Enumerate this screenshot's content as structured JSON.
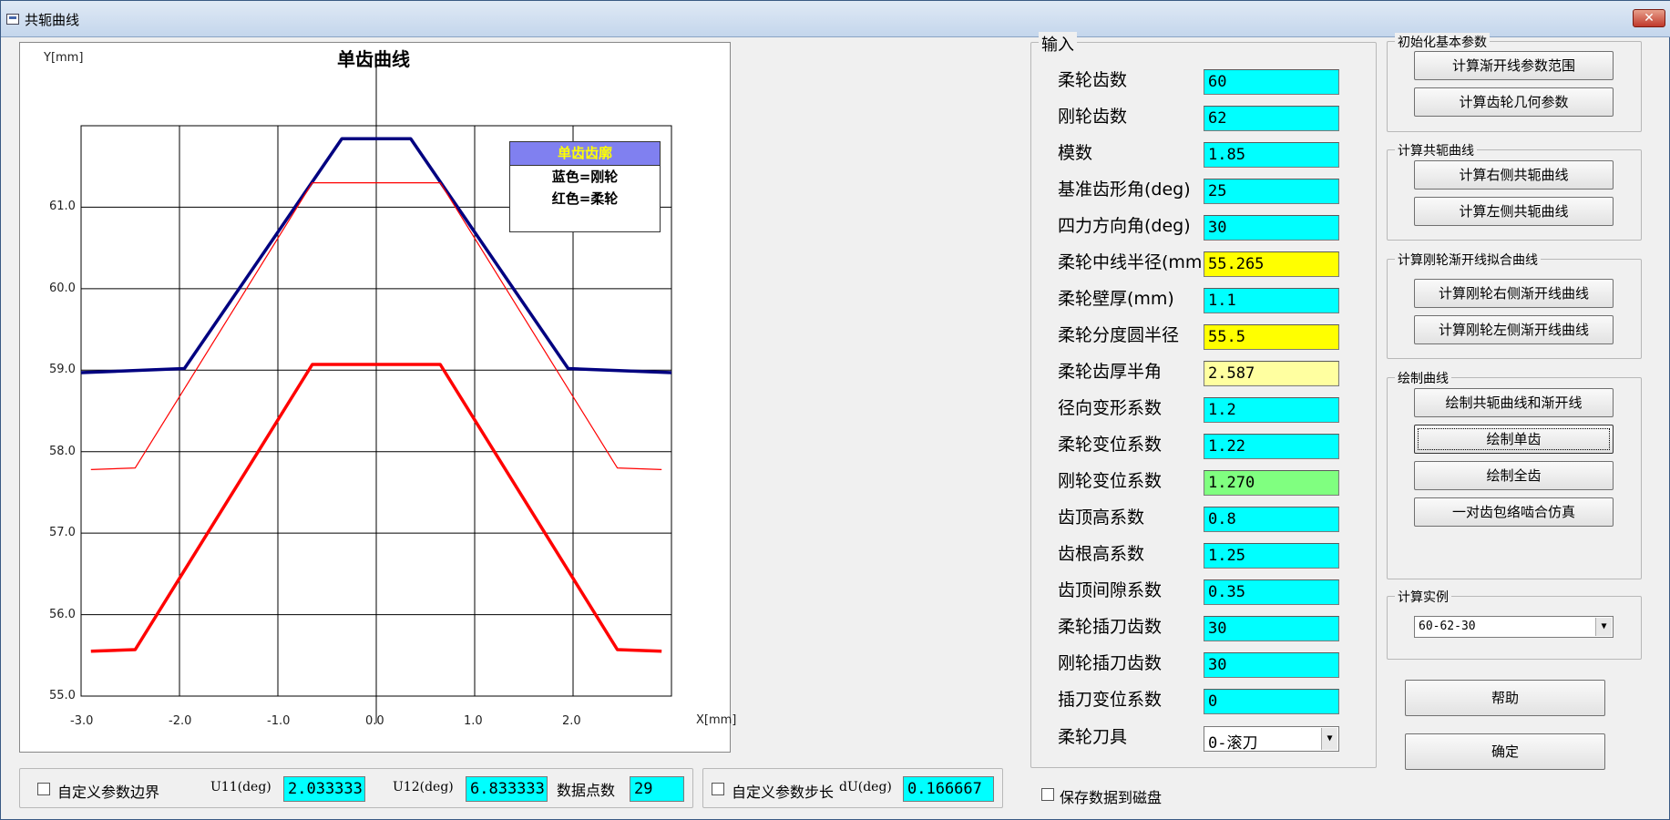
{
  "window": {
    "title": "共轭曲线",
    "close_label": "✕"
  },
  "chart_data": {
    "type": "line",
    "title": "单齿曲线",
    "ylabel": "Y[mm]",
    "xlabel": "X[mm]",
    "xlim": [
      -3.0,
      3.0
    ],
    "ylim": [
      55.0,
      62.0
    ],
    "xticks": [
      "-3.0",
      "-2.0",
      "-1.0",
      "0.0",
      "1.0",
      "2.0"
    ],
    "yticks": [
      "61.0",
      "60.0",
      "59.0",
      "58.0",
      "57.0",
      "56.0",
      "55.0"
    ],
    "grid": true,
    "legend": {
      "header": "单齿齿廓",
      "items": [
        "蓝色=刚轮",
        "红色=柔轮"
      ],
      "placement": "top-right"
    },
    "series": [
      {
        "color": "#000080",
        "x": [
          -3.0,
          -1.95,
          -0.35,
          0.35,
          1.95,
          3.0
        ],
        "y": [
          58.97,
          59.02,
          61.84,
          61.84,
          59.02,
          58.97
        ]
      },
      {
        "color": "#ff0000",
        "x": [
          -2.9,
          -2.45,
          -0.65,
          0.65,
          2.45,
          2.9
        ],
        "y": [
          55.55,
          55.57,
          59.07,
          59.07,
          55.57,
          55.55
        ]
      },
      {
        "color": "#ff0000",
        "thin": true,
        "x": [
          -2.9,
          -2.45,
          -0.65,
          0.65,
          2.45,
          2.9
        ],
        "y": [
          57.78,
          57.8,
          61.3,
          61.3,
          57.8,
          57.78
        ]
      }
    ]
  },
  "input_group": {
    "title": "输入",
    "fields": [
      {
        "label": "柔轮齿数",
        "value": "60",
        "color": "cyan"
      },
      {
        "label": "刚轮齿数",
        "value": "62",
        "color": "cyan"
      },
      {
        "label": "模数",
        "value": "1.85",
        "color": "cyan"
      },
      {
        "label": "基准齿形角(deg)",
        "value": "25",
        "color": "cyan"
      },
      {
        "label": "四力方向角(deg)",
        "value": "30",
        "color": "cyan"
      },
      {
        "label": "柔轮中线半径(mm)",
        "value": "55.265",
        "color": "yellow"
      },
      {
        "label": "柔轮壁厚(mm)",
        "value": "1.1",
        "color": "cyan"
      },
      {
        "label": "柔轮分度圆半径",
        "value": "55.5",
        "color": "yellow"
      },
      {
        "label": "柔轮齿厚半角",
        "value": "2.587",
        "color": "lightyellow"
      },
      {
        "label": "径向变形系数",
        "value": "1.2",
        "color": "cyan"
      },
      {
        "label": "柔轮变位系数",
        "value": "1.22",
        "color": "cyan"
      },
      {
        "label": "刚轮变位系数",
        "value": "1.270",
        "color": "green"
      },
      {
        "label": "齿顶高系数",
        "value": "0.8",
        "color": "cyan"
      },
      {
        "label": "齿根高系数",
        "value": "1.25",
        "color": "cyan"
      },
      {
        "label": "齿顶间隙系数",
        "value": "0.35",
        "color": "cyan"
      },
      {
        "label": "柔轮插刀齿数",
        "value": "30",
        "color": "cyan"
      },
      {
        "label": "刚轮插刀齿数",
        "value": "30",
        "color": "cyan"
      },
      {
        "label": "插刀变位系数",
        "value": "0",
        "color": "cyan"
      }
    ],
    "tool_label": "柔轮刀具",
    "tool_value": "0-滚刀"
  },
  "groups": {
    "init": {
      "title": "初始化基本参数",
      "buttons": [
        "计算渐开线参数范围",
        "计算齿轮几何参数"
      ]
    },
    "conj": {
      "title": "计算共轭曲线",
      "buttons": [
        "计算右侧共轭曲线",
        "计算左侧共轭曲线"
      ]
    },
    "fit": {
      "title": "计算刚轮渐开线拟合曲线",
      "buttons": [
        "计算刚轮右侧渐开线曲线",
        "计算刚轮左侧渐开线曲线"
      ]
    },
    "draw": {
      "title": "绘制曲线",
      "buttons": [
        "绘制共轭曲线和渐开线",
        "绘制单齿",
        "绘制全齿",
        "一对齿包络啮合仿真"
      ]
    },
    "example": {
      "title": "计算实例",
      "selected": "60-62-30"
    }
  },
  "help_label": "帮助",
  "ok_label": "确定",
  "bottom": {
    "custom_bounds_label": "自定义参数边界",
    "u11_label": "U11(deg)",
    "u11_value": "2.033333",
    "u12_label": "U12(deg)",
    "u12_value": "6.833333",
    "points_label": "数据点数",
    "points_value": "29",
    "custom_step_label": "自定义参数步长",
    "du_label": "dU(deg)",
    "du_value": "0.166667",
    "save_label": "保存数据到磁盘"
  }
}
